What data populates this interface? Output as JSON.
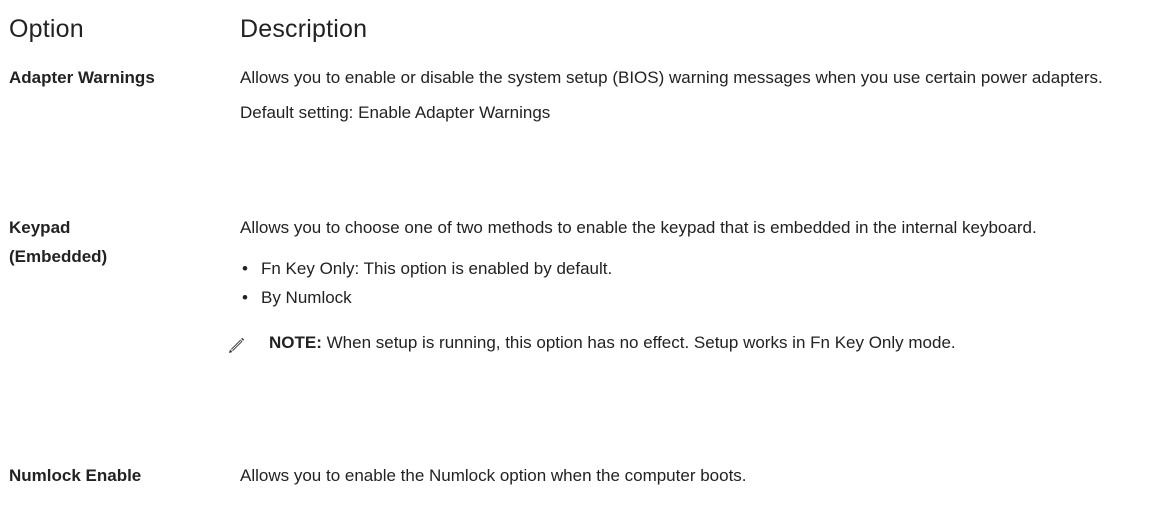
{
  "header": {
    "option": "Option",
    "description": "Description"
  },
  "rows": [
    {
      "label": "Adapter Warnings",
      "description": "Allows you to enable or disable the system setup (BIOS) warning messages when you use certain power adapters.",
      "default": "Default setting: Enable Adapter Warnings"
    },
    {
      "label_line1": "Keypad",
      "label_line2": "(Embedded)",
      "description": "Allows you to choose one of two methods to enable the keypad that is embedded in the internal keyboard.",
      "bullets": [
        "Fn Key Only: This option is enabled by default.",
        "By Numlock"
      ],
      "note": {
        "icon": "pencil-icon",
        "label": "NOTE:",
        "text": " When setup is running, this option has no effect. Setup works in Fn Key Only mode."
      }
    },
    {
      "label": "Numlock Enable",
      "description": "Allows you to enable the Numlock option when the computer boots."
    }
  ]
}
